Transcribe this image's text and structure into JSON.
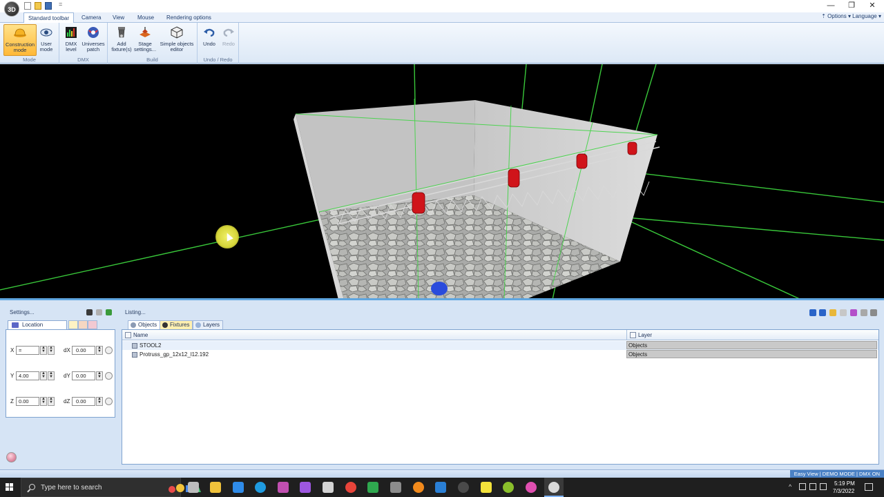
{
  "window": {
    "logo": "3D",
    "qat_more": "=",
    "min": "—",
    "max": "❐",
    "close": "✕"
  },
  "ribbon_tabs": [
    "Standard toolbar",
    "Camera",
    "View",
    "Mouse",
    "Rendering options"
  ],
  "options_label": "Options",
  "language_label": "Language",
  "ribbon": {
    "groups": [
      {
        "label": "Mode",
        "buttons": [
          {
            "label": "Construction mode",
            "icon": "construction-helmet-icon"
          },
          {
            "label": "User mode",
            "icon": "eye-icon"
          }
        ]
      },
      {
        "label": "DMX",
        "buttons": [
          {
            "label": "DMX level",
            "icon": "dmx-level-icon"
          },
          {
            "label": "Universes patch",
            "icon": "universe-icon"
          }
        ]
      },
      {
        "label": "Build",
        "buttons": [
          {
            "label": "Add fixture(s)",
            "icon": "fixture-icon"
          },
          {
            "label": "Stage settings...",
            "icon": "stage-icon"
          },
          {
            "label": "Simple objects editor",
            "icon": "cube-icon"
          }
        ]
      },
      {
        "label": "Undo / Redo",
        "buttons": [
          {
            "label": "Undo",
            "icon": "undo-icon"
          },
          {
            "label": "Redo",
            "icon": "redo-icon"
          }
        ]
      }
    ]
  },
  "settings": {
    "title": "Settings...",
    "tab_location": "Location",
    "rows": [
      {
        "axis": "X",
        "value": "=",
        "delta_label": "dX",
        "delta": "0.00"
      },
      {
        "axis": "Y",
        "value": "4.00",
        "delta_label": "dY",
        "delta": "0.00"
      },
      {
        "axis": "Z",
        "value": "0.00",
        "delta_label": "dZ",
        "delta": "0.00"
      }
    ],
    "spin_up": "▲",
    "spin_down": "▼"
  },
  "listing": {
    "title": "Listing...",
    "tabs": [
      "Objects",
      "Fixtures",
      "Layers"
    ],
    "col_name": "Name",
    "col_layer": "Layer",
    "rows": [
      {
        "name": "STOOL2",
        "layer": "Objects"
      },
      {
        "name": "Protruss_gp_12x12_l12.192",
        "layer": "Objects"
      }
    ]
  },
  "status": "Easy View  |  DEMO MODE  |  DMX ON",
  "taskbar": {
    "search_placeholder": "Type here to search",
    "time": "5:19 PM",
    "date": "7/3/2022",
    "tray_arrow": "^"
  },
  "colors": {
    "viewport_bg": "#000000",
    "grid": "#39c83a",
    "fixture": "#d0141a",
    "accent": "#4a81c5"
  }
}
